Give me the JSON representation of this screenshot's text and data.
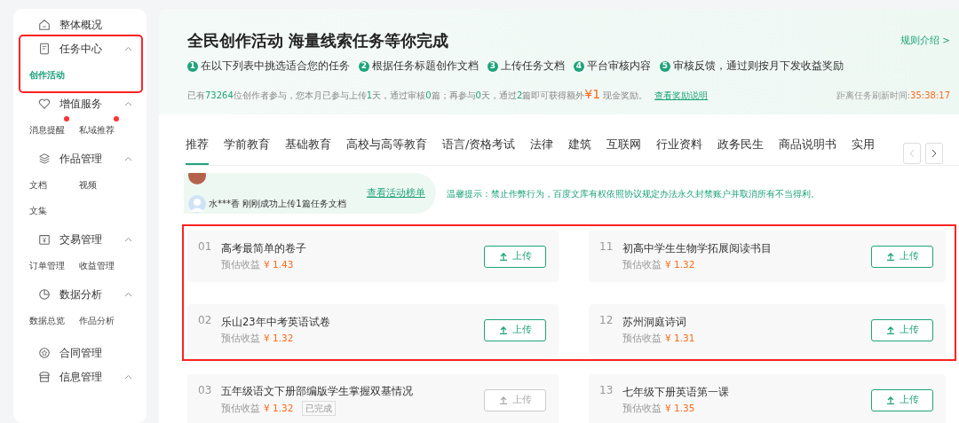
{
  "sidebar": {
    "sections": [
      {
        "label": "整体概况",
        "highlighted": false
      },
      {
        "label": "任务中心",
        "expanded": true,
        "highlighted": true,
        "children": [
          {
            "label": "创作活动",
            "selected": true,
            "dot": false
          }
        ]
      },
      {
        "label": "增值服务",
        "expanded": true,
        "highlighted": false,
        "children": [
          {
            "label": "消息提醒",
            "selected": false,
            "dot": true
          },
          {
            "label": "私域推荐",
            "selected": false,
            "dot": true
          }
        ]
      },
      {
        "label": "作品管理",
        "expanded": true,
        "highlighted": false,
        "children": [
          {
            "label": "文档",
            "selected": false,
            "dot": false
          },
          {
            "label": "视频",
            "selected": false,
            "dot": false
          },
          {
            "label": "文集",
            "selected": false,
            "dot": false
          }
        ]
      },
      {
        "label": "交易管理",
        "expanded": true,
        "highlighted": false,
        "children": [
          {
            "label": "订单管理",
            "selected": false,
            "dot": false
          },
          {
            "label": "收益管理",
            "selected": false,
            "dot": false
          }
        ]
      },
      {
        "label": "数据分析",
        "expanded": true,
        "highlighted": false,
        "children": [
          {
            "label": "数据总览",
            "selected": false,
            "dot": false
          },
          {
            "label": "作品分析",
            "selected": false,
            "dot": false
          }
        ]
      },
      {
        "label": "合同管理",
        "highlighted": false
      },
      {
        "label": "信息管理",
        "expanded": true,
        "highlighted": false
      }
    ]
  },
  "banner": {
    "title": "全民创作活动 海量线索任务等你完成",
    "rules_link": "规则介绍 >",
    "steps": [
      {
        "number": "1",
        "text": "在以下列表中挑选适合您的任务"
      },
      {
        "number": "2",
        "text": "根据任务标题创作文档"
      },
      {
        "number": "3",
        "text": "上传任务文档"
      },
      {
        "number": "4",
        "text": "平台审核内容"
      },
      {
        "number": "5",
        "text": "审核反馈，通过则按月下发收益奖励"
      }
    ],
    "stats": [
      {
        "kind": "plain",
        "text": "已有"
      },
      {
        "kind": "num",
        "text": "73264"
      },
      {
        "kind": "plain",
        "text": "位创作者参与，您本月已参与上传"
      },
      {
        "kind": "num",
        "text": "1"
      },
      {
        "kind": "plain",
        "text": "天，通过审核"
      },
      {
        "kind": "num",
        "text": "0"
      },
      {
        "kind": "plain",
        "text": "篇；再参与"
      },
      {
        "kind": "num",
        "text": "0"
      },
      {
        "kind": "plain",
        "text": "天，通过"
      },
      {
        "kind": "num",
        "text": "2"
      },
      {
        "kind": "plain",
        "text": "篇即可获得额外"
      },
      {
        "kind": "money",
        "text": "¥1"
      },
      {
        "kind": "plain",
        "text": " 现金奖励。"
      }
    ],
    "reward_link": "查看奖励说明",
    "refresh_label": "距离任务刷新时间:",
    "refresh_time": "35:38:17"
  },
  "tabs": [
    {
      "label": "推荐",
      "selected": true
    },
    {
      "label": "学前教育",
      "selected": false
    },
    {
      "label": "基础教育",
      "selected": false
    },
    {
      "label": "高校与高等教育",
      "selected": false
    },
    {
      "label": "语言/资格考试",
      "selected": false
    },
    {
      "label": "法律",
      "selected": false
    },
    {
      "label": "建筑",
      "selected": false
    },
    {
      "label": "互联网",
      "selected": false
    },
    {
      "label": "行业资料",
      "selected": false
    },
    {
      "label": "政务民生",
      "selected": false
    },
    {
      "label": "商品说明书",
      "selected": false
    },
    {
      "label": "实用",
      "selected": false
    }
  ],
  "ticker": {
    "message": "水***香 刚刚成功上传1篇任务文档",
    "link": "查看活动榜单"
  },
  "notice": "温馨提示：禁止作弊行为，百度文库有权依照协议规定办法永久封禁账户并取消所有不当得利。",
  "task_groups": [
    {
      "highlighted": true,
      "tasks": [
        {
          "number": "01",
          "title": "高考最简单的卷子",
          "earn_label": "预估收益",
          "amount": "¥ 1.43",
          "done": false,
          "button": "上传"
        },
        {
          "number": "11",
          "title": "初高中学生生物学拓展阅读书目",
          "earn_label": "预估收益",
          "amount": "¥ 1.32",
          "done": false,
          "button": "上传"
        },
        {
          "number": "02",
          "title": "乐山23年中考英语试卷",
          "earn_label": "预估收益",
          "amount": "¥ 1.32",
          "done": false,
          "button": "上传"
        },
        {
          "number": "12",
          "title": "苏州洞庭诗词",
          "earn_label": "预估收益",
          "amount": "¥ 1.31",
          "done": false,
          "button": "上传"
        }
      ]
    },
    {
      "highlighted": false,
      "tasks": [
        {
          "number": "03",
          "title": "五年级语文下册部编版学生掌握双基情况",
          "earn_label": "预估收益",
          "amount": "¥ 1.32",
          "done": true,
          "done_label": "已完成",
          "button": "上传"
        },
        {
          "number": "13",
          "title": "七年级下册英语第一课",
          "earn_label": "预估收益",
          "amount": "¥ 1.35",
          "done": false,
          "button": "上传"
        }
      ]
    }
  ]
}
